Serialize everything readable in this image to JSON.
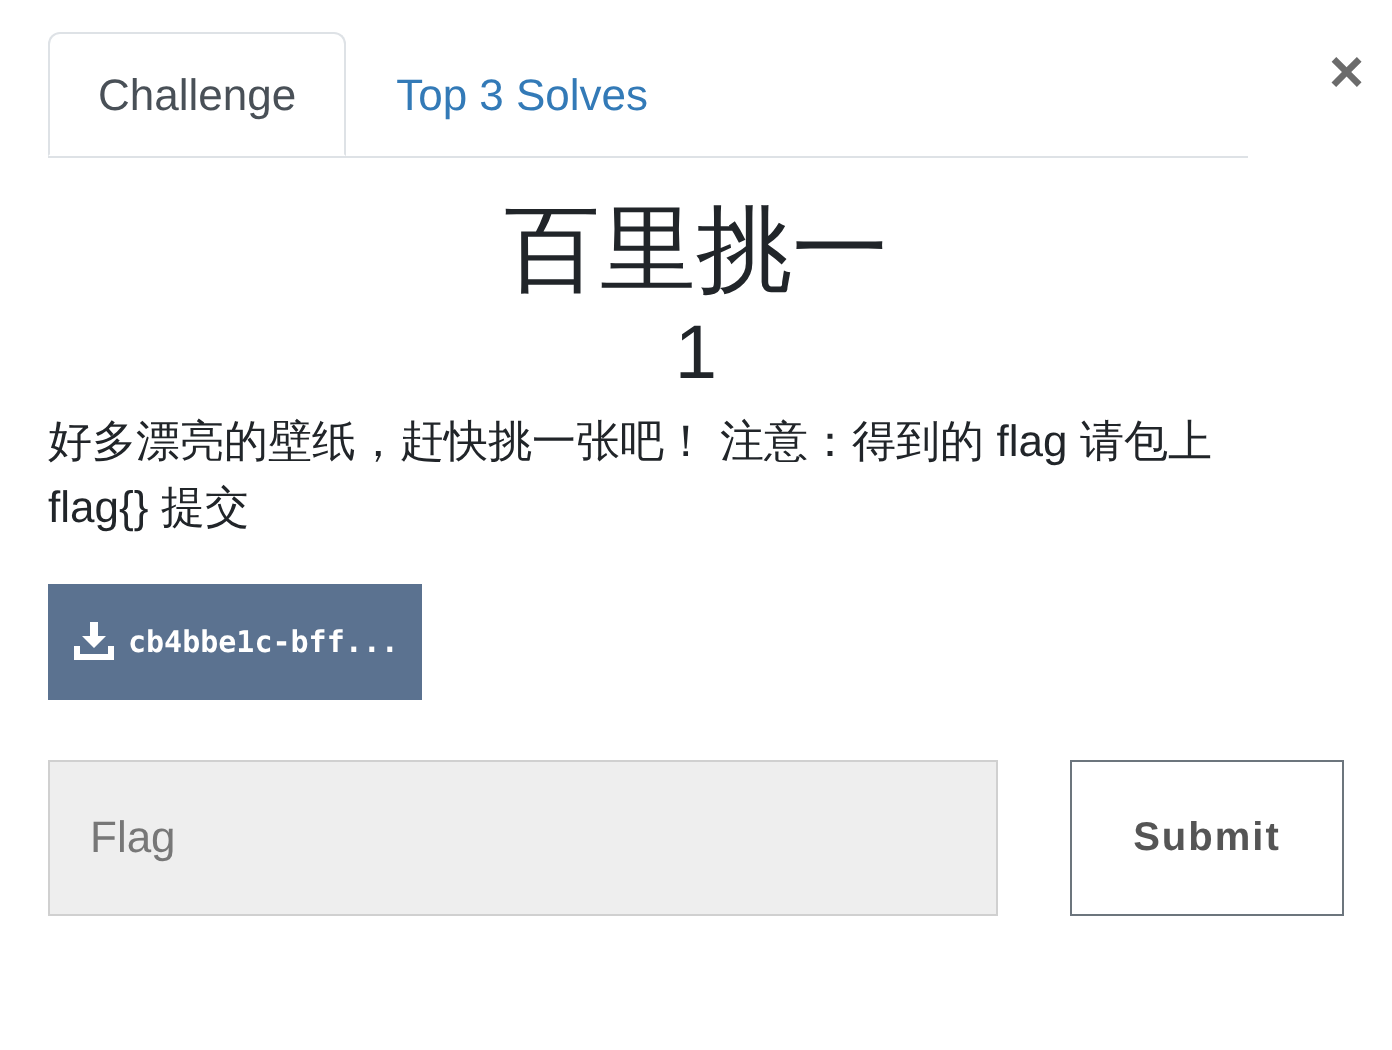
{
  "tabs": [
    {
      "label": "Challenge",
      "selected": true
    },
    {
      "label": "Top 3 Solves",
      "selected": false
    }
  ],
  "close": "×",
  "challenge": {
    "name": "百里挑一",
    "value": "1",
    "description": "好多漂亮的壁纸，赶快挑一张吧！ 注意：得到的 flag 请包上 flag{} 提交"
  },
  "files": [
    {
      "label": "cb4bbe1c-bff..."
    }
  ],
  "flag_input": {
    "placeholder": "Flag"
  },
  "submit": "Submit"
}
